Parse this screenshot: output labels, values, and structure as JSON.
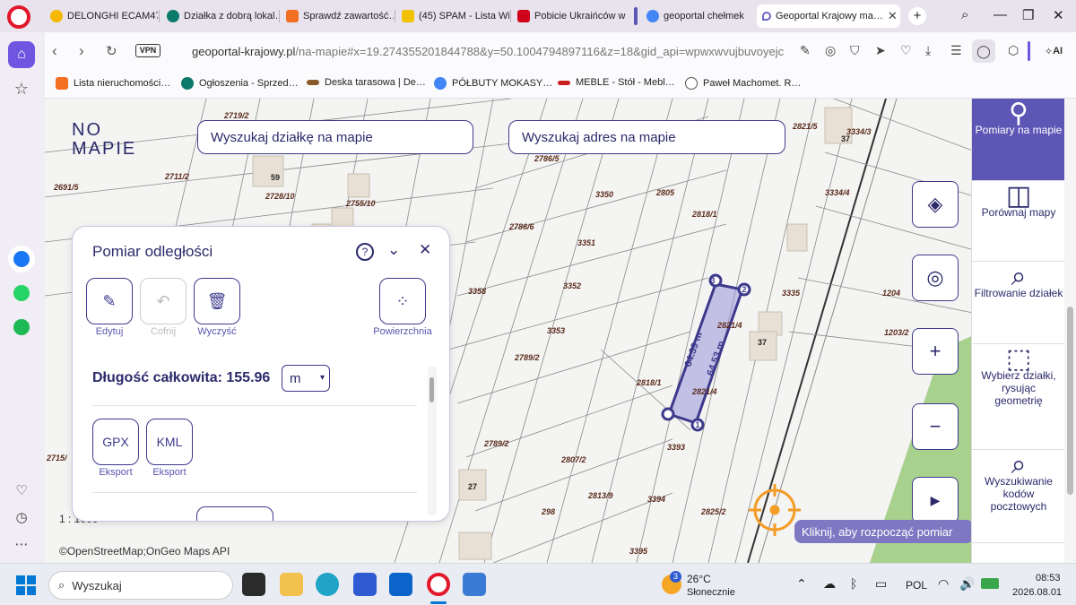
{
  "tabs": [
    {
      "title": "DELONGHI ECAM47…",
      "favicon_color": "#f5b800"
    },
    {
      "title": "Działka z dobrą lokal…",
      "favicon_color": "#0c7a6b"
    },
    {
      "title": "Sprawdź zawartość…",
      "favicon_color": "#f36f21"
    },
    {
      "title": "(45) SPAM - Lista Wi…",
      "favicon_color": "#f2c200"
    },
    {
      "title": "Pobicie Ukraińców w…",
      "favicon_color": "#d0021b"
    },
    {
      "title": "geoportal chełmek",
      "favicon_color": "#4285f4"
    },
    {
      "title": "Geoportal Krajowy ma…",
      "favicon_color": "#6e67c8",
      "active": true
    }
  ],
  "browser": {
    "vpn_label": "VPN",
    "url_host": "geoportal-krajowy.pl",
    "url_path": "/na-mapie#x=19.274355201844788&y=50.1004794897116&z=18&gid_api=wpwxwvujbuvoyejcpjiyn",
    "ai_label": "AI"
  },
  "bookmarks": [
    {
      "title": "Lista nieruchomości…",
      "favicon_color": "#f36f21"
    },
    {
      "title": "Ogłoszenia - Sprzed…",
      "favicon_color": "#0c7a6b"
    },
    {
      "title": "Deska tarasowa | De…",
      "favicon_color": "#8b5a2b"
    },
    {
      "title": "PÓŁBUTY MOKASY…",
      "favicon_color": "#4285f4"
    },
    {
      "title": "MEBLE - Stół - Mebl…",
      "favicon_color": "#c81e1e"
    },
    {
      "title": "Paweł Machomet. R…",
      "favicon_color": "#555555"
    }
  ],
  "map": {
    "logo_top": "NO",
    "logo_bottom": "MAPIE",
    "search_plot": "Wyszukaj działkę na mapie",
    "search_address": "Wyszukaj adres na mapie",
    "hint": "Kliknij, aby rozpocząć pomiar",
    "attribution": "©OpenStreetMap;OnGeo Maps API",
    "scale": "1 : 1000",
    "plot_labels": [
      "2719/2",
      "2711/2",
      "2691/5",
      "2728/10",
      "2755/10",
      "2786/5",
      "3350",
      "2805",
      "2818/1",
      "2786/6",
      "3351",
      "3358",
      "3352",
      "3353",
      "2789/2",
      "2818/1",
      "2821/4",
      "2821/4",
      "3393",
      "2789/2",
      "2807/2",
      "2813/9",
      "3394",
      "298",
      "2825/2",
      "3395",
      "2821/5",
      "3334/3",
      "3334/4",
      "3335",
      "1204",
      "1203/2",
      "2715/"
    ],
    "building_labels": [
      "59",
      "37",
      "37",
      "27"
    ],
    "measure_labels": [
      "64.39 m",
      "64.53 m"
    ],
    "vertex_labels": [
      "1",
      "2",
      "3"
    ]
  },
  "panel": {
    "title": "Pomiar odległości",
    "tools": [
      {
        "label": "Edytuj",
        "icon": "pencil-icon",
        "enabled": true
      },
      {
        "label": "Cofnij",
        "icon": "undo-icon",
        "enabled": false
      },
      {
        "label": "Wyczyść",
        "icon": "trash-icon",
        "enabled": true
      },
      {
        "label": "Powierzchnia",
        "icon": "area-icon",
        "enabled": true
      }
    ],
    "total_label": "Długość całkowita:",
    "total_value": "155.96",
    "unit": "m",
    "exports": [
      {
        "format": "GPX",
        "label": "Eksport"
      },
      {
        "format": "KML",
        "label": "Eksport"
      }
    ]
  },
  "right_panel": [
    {
      "label": "Pomiary na mapie",
      "icon": "measure-icon",
      "active": true
    },
    {
      "label": "Porównaj mapy",
      "icon": "compare-icon"
    },
    {
      "label": "Filtrowanie działek",
      "icon": "filter-map-icon"
    },
    {
      "label": "Wybierz działki, rysując geometrię",
      "icon": "select-draw-icon"
    },
    {
      "label": "Wyszukiwanie kodów pocztowych",
      "icon": "postcode-search-icon"
    }
  ],
  "taskbar": {
    "search_placeholder": "Wyszukaj",
    "weather_temp": "26°C",
    "weather_desc": "Słonecznie",
    "weather_badge": "3",
    "lang": "POL",
    "time": "08:53",
    "date": "2026.08.01"
  },
  "colors": {
    "brand": "#2b2a6b",
    "accent": "#5c57b5",
    "measure": "#3d3a8c",
    "crosshair": "#f39c26",
    "green_area": "#a9d18e"
  }
}
